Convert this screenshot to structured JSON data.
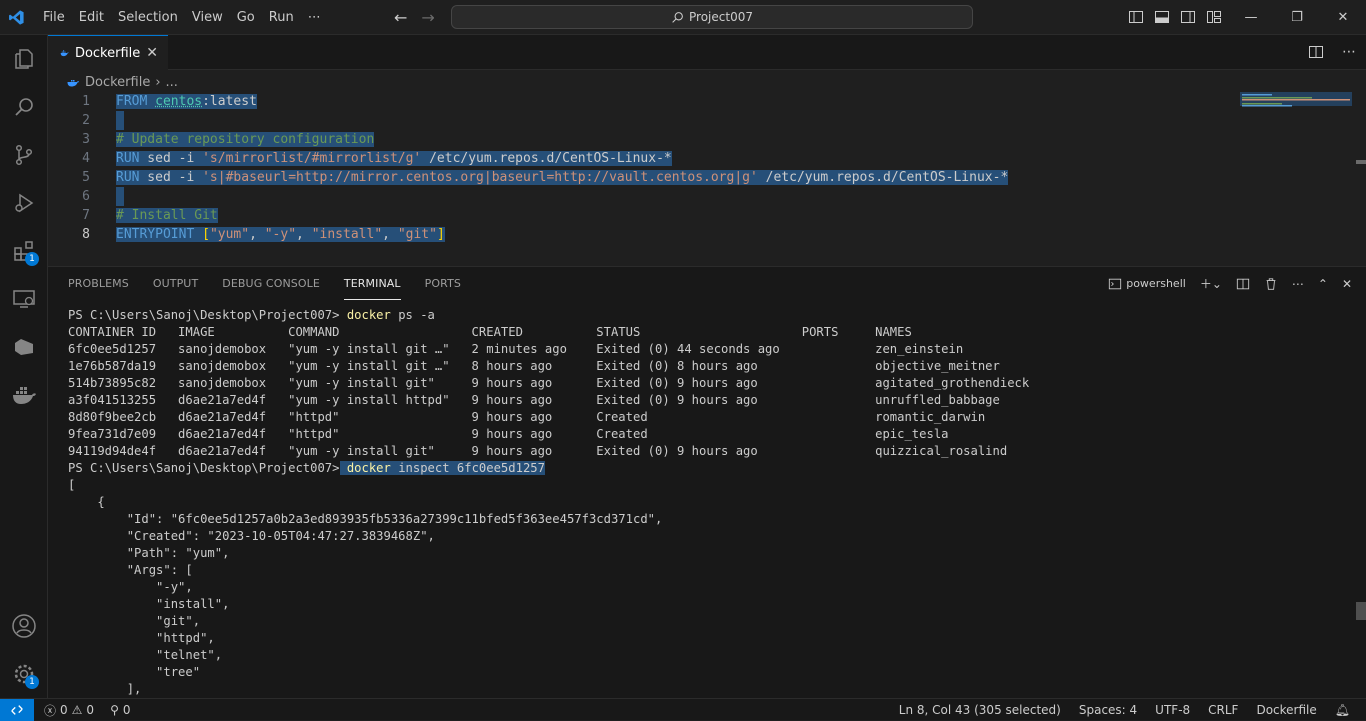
{
  "menu": [
    "File",
    "Edit",
    "Selection",
    "View",
    "Go",
    "Run",
    "⋯"
  ],
  "search": {
    "label": "Project007"
  },
  "activity_badges": {
    "extensions": "1",
    "settings": "1"
  },
  "tab": {
    "label": "Dockerfile",
    "close": "✕"
  },
  "breadcrumb": {
    "file": "Dockerfile",
    "sep": "›",
    "more": "..."
  },
  "editor": {
    "lines": [
      {
        "n": "1"
      },
      {
        "n": "2"
      },
      {
        "n": "3"
      },
      {
        "n": "4"
      },
      {
        "n": "5"
      },
      {
        "n": "6"
      },
      {
        "n": "7"
      },
      {
        "n": "8"
      }
    ],
    "code": {
      "l1a": "FROM",
      "l1b": "centos",
      "l1c": ":latest",
      "l3": "# Update repository configuration",
      "l4a": "RUN",
      "l4b": " sed -i ",
      "l4c": "'s/mirrorlist/#mirrorlist/g'",
      "l4d": " /etc/yum.repos.d/CentOS-Linux-*",
      "l5a": "RUN",
      "l5b": " sed -i ",
      "l5c": "'s|#baseurl=http://mirror.centos.org|baseurl=http://vault.centos.org|g'",
      "l5d": " /etc/yum.repos.d/CentOS-Linux-*",
      "l7": "# Install Git",
      "l8a": "ENTRYPOINT",
      "l8b": "[",
      "l8c": "\"yum\"",
      "l8d": ", ",
      "l8e": "\"-y\"",
      "l8f": "\"install\"",
      "l8g": "\"git\"",
      "l8h": "]"
    }
  },
  "panel": {
    "tabs": [
      "PROBLEMS",
      "OUTPUT",
      "DEBUG CONSOLE",
      "TERMINAL",
      "PORTS"
    ],
    "active_tab": "TERMINAL",
    "shell": "powershell"
  },
  "terminal": {
    "prompt1": "PS C:\\Users\\Sanoj\\Desktop\\Project007> ",
    "cmd1a": "docker",
    "cmd1b": " ps -a",
    "header": "CONTAINER ID   IMAGE          COMMAND                  CREATED          STATUS                      PORTS     NAMES",
    "rows": [
      "6fc0ee5d1257   sanojdemobox   \"yum -y install git …\"   2 minutes ago    Exited (0) 44 seconds ago             zen_einstein",
      "1e76b587da19   sanojdemobox   \"yum -y install git …\"   8 hours ago      Exited (0) 8 hours ago                objective_meitner",
      "514b73895c82   sanojdemobox   \"yum -y install git\"     9 hours ago      Exited (0) 9 hours ago                agitated_grothendieck",
      "a3f041513255   d6ae21a7ed4f   \"yum -y install httpd\"   9 hours ago      Exited (0) 9 hours ago                unruffled_babbage",
      "8d80f9bee2cb   d6ae21a7ed4f   \"httpd\"                  9 hours ago      Created                               romantic_darwin",
      "9fea731d7e09   d6ae21a7ed4f   \"httpd\"                  9 hours ago      Created                               epic_tesla",
      "94119d94de4f   d6ae21a7ed4f   \"yum -y install git\"     9 hours ago      Exited (0) 9 hours ago                quizzical_rosalind"
    ],
    "prompt2": "PS C:\\Users\\Sanoj\\Desktop\\Project007>",
    "cmd2a": " docker",
    "cmd2b": " inspect 6fc0ee5d1257",
    "json_lines": [
      "[",
      "    {",
      "        \"Id\": \"6fc0ee5d1257a0b2a3ed893935fb5336a27399c11bfed5f363ee457f3cd371cd\",",
      "        \"Created\": \"2023-10-05T04:47:27.3839468Z\",",
      "        \"Path\": \"yum\",",
      "        \"Args\": [",
      "            \"-y\",",
      "            \"install\",",
      "            \"git\",",
      "            \"httpd\",",
      "            \"telnet\",",
      "            \"tree\"",
      "        ],"
    ]
  },
  "status": {
    "errors": "0",
    "warnings": "0",
    "ports": "0",
    "position": "Ln 8, Col 43 (305 selected)",
    "spaces": "Spaces: 4",
    "encoding": "UTF-8",
    "eol": "CRLF",
    "language": "Dockerfile"
  },
  "colors": {
    "accent": "#0078d4",
    "selection": "#264f78",
    "keyword": "#569cd6",
    "string": "#ce9178",
    "comment": "#6a9955"
  }
}
